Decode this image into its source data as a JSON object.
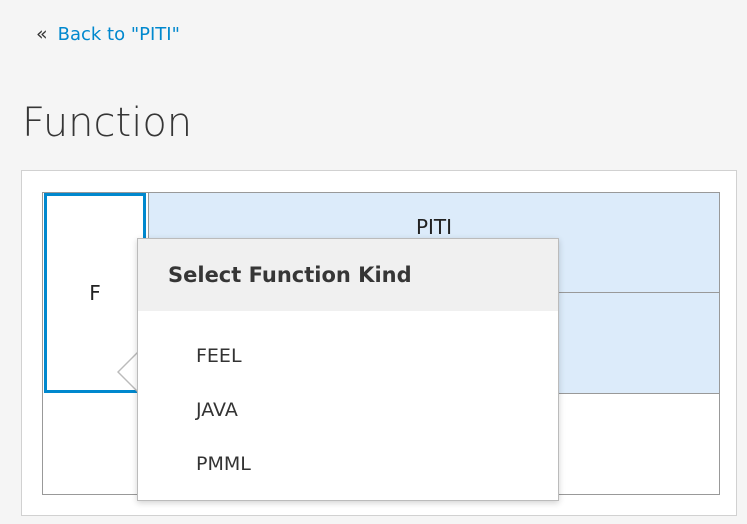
{
  "nav": {
    "back_icon": "«",
    "back_label": "Back to \"PITI\""
  },
  "page": {
    "title": "Function"
  },
  "grid": {
    "kind_cell": "F",
    "name_cell": "PITI"
  },
  "popover": {
    "title": "Select Function Kind",
    "options": [
      "FEEL",
      "JAVA",
      "PMML"
    ]
  },
  "colors": {
    "link": "#0088ce",
    "selection_border": "#0088ce",
    "cell_highlight": "#dcebfa"
  }
}
